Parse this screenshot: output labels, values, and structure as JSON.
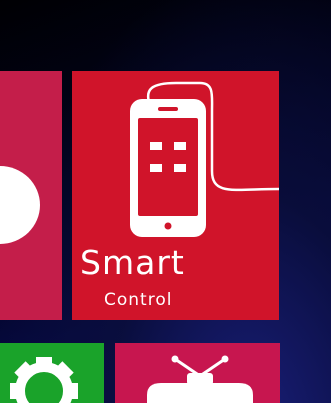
{
  "tiles": {
    "left": {
      "icon": "circle-icon",
      "color": "#c41e4a"
    },
    "smart_control": {
      "title": "Smart",
      "subtitle": "Control",
      "icon": "smartphone-icon",
      "color": "#d0142a"
    },
    "settings": {
      "icon": "gear-icon",
      "color": "#1aa32a"
    },
    "tv": {
      "icon": "tv-icon",
      "color": "#c7164f"
    }
  }
}
